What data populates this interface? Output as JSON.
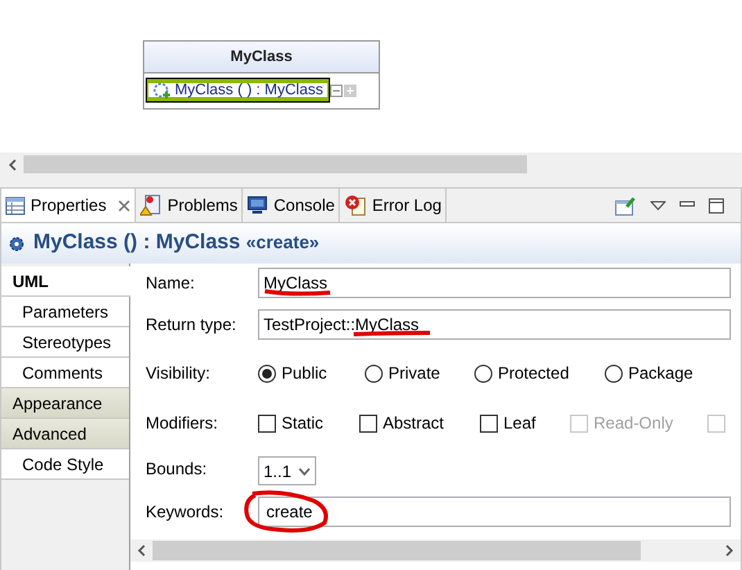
{
  "diagram": {
    "class_name": "MyClass",
    "operation": "MyClass ( ) :  MyClass",
    "operation_selected": true
  },
  "tabs": [
    {
      "label": "Properties",
      "selected": true
    },
    {
      "label": "Problems",
      "selected": false
    },
    {
      "label": "Console",
      "selected": false
    },
    {
      "label": "Error Log",
      "selected": false
    }
  ],
  "header": {
    "title": "MyClass () : MyClass",
    "stereotype": "«create»"
  },
  "sidebar": {
    "items": [
      {
        "label": "UML",
        "kind": "page",
        "selected": true
      },
      {
        "label": "Parameters",
        "kind": "page",
        "selected": false
      },
      {
        "label": "Stereotypes",
        "kind": "page",
        "selected": false
      },
      {
        "label": "Comments",
        "kind": "page",
        "selected": false
      },
      {
        "label": "Appearance",
        "kind": "category",
        "selected": false
      },
      {
        "label": "Advanced",
        "kind": "category",
        "selected": false
      },
      {
        "label": "Code Style",
        "kind": "page",
        "selected": false
      }
    ]
  },
  "form": {
    "name": {
      "label": "Name:",
      "value": "MyClass"
    },
    "return_type": {
      "label": "Return type:",
      "prefix": "TestProject::",
      "value": "MyClass"
    },
    "visibility": {
      "label": "Visibility:",
      "options": [
        {
          "label": "Public",
          "selected": true
        },
        {
          "label": "Private",
          "selected": false
        },
        {
          "label": "Protected",
          "selected": false
        },
        {
          "label": "Package",
          "selected": false
        }
      ]
    },
    "modifiers": {
      "label": "Modifiers:",
      "options": [
        {
          "label": "Static",
          "checked": false,
          "disabled": false
        },
        {
          "label": "Abstract",
          "checked": false,
          "disabled": false
        },
        {
          "label": "Leaf",
          "checked": false,
          "disabled": false
        },
        {
          "label": "Read-Only",
          "checked": false,
          "disabled": true
        },
        {
          "checked": false,
          "disabled": true
        }
      ]
    },
    "bounds": {
      "label": "Bounds:",
      "value": "1..1"
    },
    "keywords": {
      "label": "Keywords:",
      "value": "create"
    }
  }
}
